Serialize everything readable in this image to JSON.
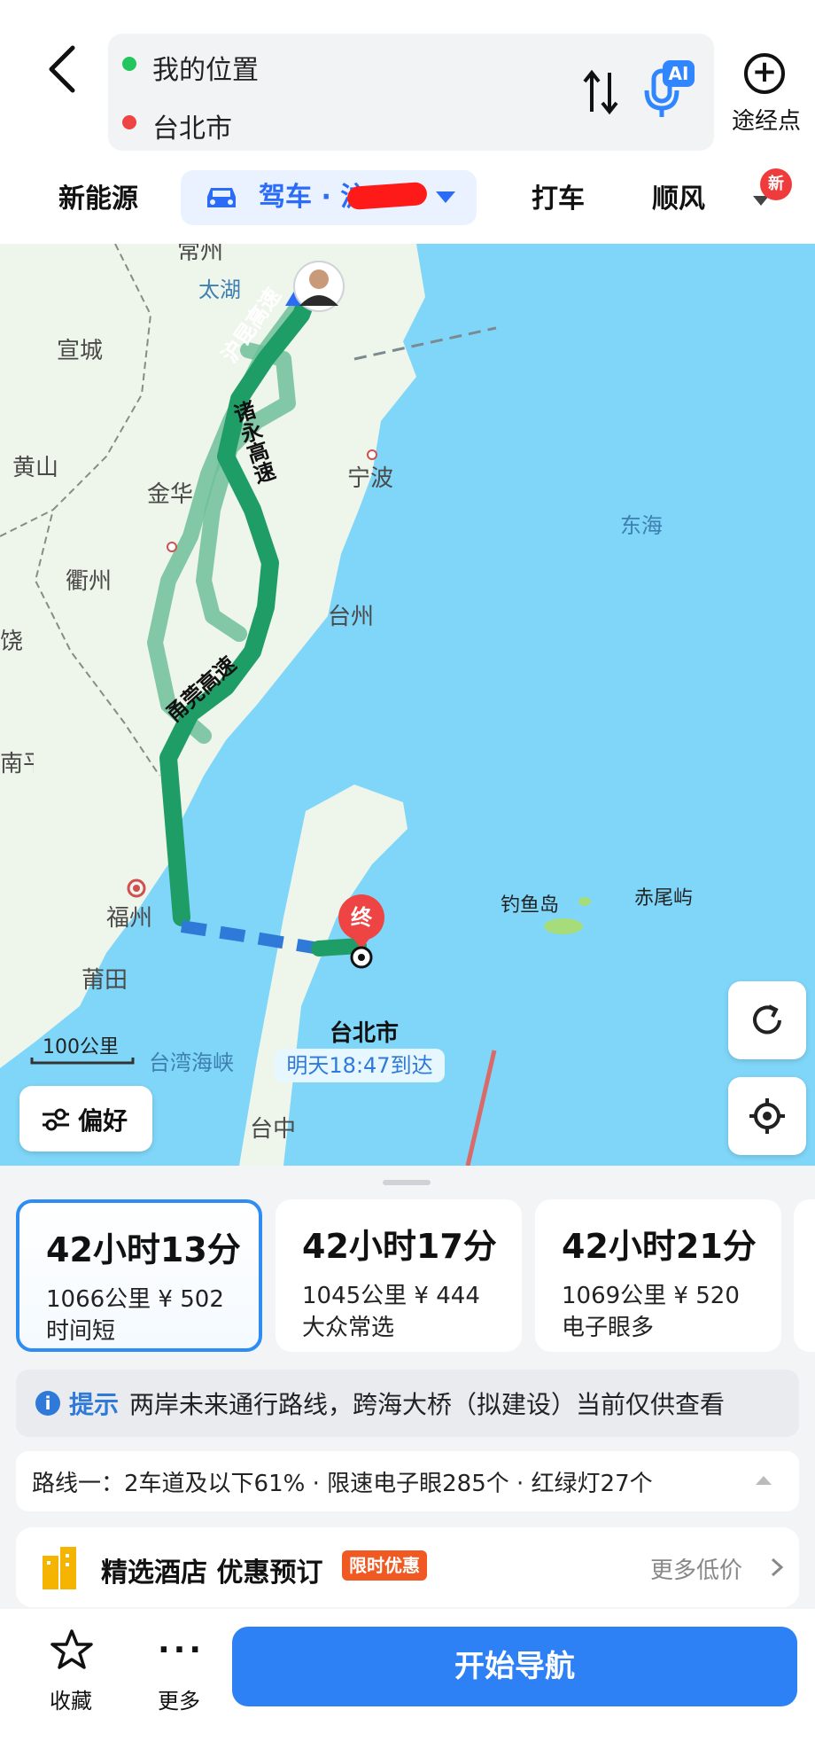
{
  "header": {
    "origin": "我的位置",
    "destination": "台北市",
    "ai_badge": "AI",
    "waypoint_label": "途经点"
  },
  "tabs": {
    "new_energy": "新能源",
    "drive": "驾车 · 沪",
    "taxi": "打车",
    "carpool": "顺风车",
    "new_badge": "新"
  },
  "map": {
    "labels": {
      "changzhou": "常州",
      "taihu": "太湖",
      "xuancheng": "宣城",
      "huangshan": "黄山",
      "jinhua": "金华",
      "quzhou": "衢州",
      "rao": "饶",
      "ningbo": "宁波",
      "taizhou": "台州",
      "nanping": "南平",
      "fuzhou": "福州",
      "putian": "莆田",
      "donghai": "东海",
      "diaoyudao": "钓鱼岛",
      "chiweiyu": "赤尾屿",
      "taiwan_strait": "台湾海峡",
      "taizhong": "台中",
      "taibei": "台北市",
      "end_marker": "终"
    },
    "roads": {
      "hukun": "沪昆高速",
      "zhuyong": "诸永高速",
      "yongguan": "甬莞高速"
    },
    "scale": "100公里",
    "eta": "明天18:47到达",
    "preference": "偏好"
  },
  "routes": [
    {
      "time": "42小时13分",
      "detail": "1066公里  ¥ 502",
      "tag": "时间短"
    },
    {
      "time": "42小时17分",
      "detail": "1045公里  ¥ 444",
      "tag": "大众常选"
    },
    {
      "time": "42小时21分",
      "detail": "1069公里  ¥ 520",
      "tag": "电子眼多"
    }
  ],
  "tip": {
    "label": "提示",
    "text": "两岸未来通行路线，跨海大桥（拟建设）当前仅供查看"
  },
  "route_info": "路线一：2车道及以下61% · 限速电子眼285个 · 红绿灯27个",
  "hotel": {
    "title": "精选酒店 优惠预订",
    "badge": "限时优惠",
    "more": "更多低价"
  },
  "bottom": {
    "favorite": "收藏",
    "more": "更多",
    "start": "开始导航"
  },
  "colors": {
    "accent": "#2e80f5",
    "route_primary": "#1f9d67",
    "route_alt": "#6fbf9a",
    "sea": "#7fd6f8",
    "land": "#eef5ea",
    "destination": "#ef4444",
    "origin_dot": "#22c55e"
  }
}
